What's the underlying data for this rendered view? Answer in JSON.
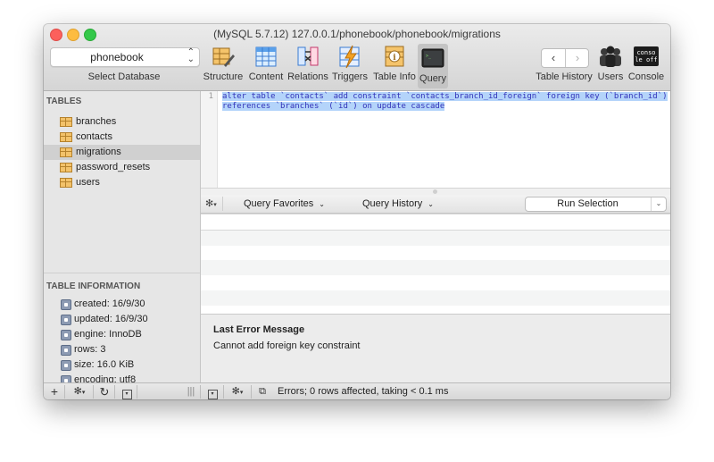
{
  "window": {
    "title": "(MySQL 5.7.12) 127.0.0.1/phonebook/phonebook/migrations"
  },
  "database": {
    "selected": "phonebook",
    "caption": "Select Database"
  },
  "toolbar": {
    "buttons": [
      {
        "label": "Structure",
        "icon": "structure-icon"
      },
      {
        "label": "Content",
        "icon": "content-icon"
      },
      {
        "label": "Relations",
        "icon": "relations-icon"
      },
      {
        "label": "Triggers",
        "icon": "triggers-icon"
      },
      {
        "label": "Table Info",
        "icon": "table-info-icon"
      },
      {
        "label": "Query",
        "icon": "query-icon",
        "active": true
      }
    ],
    "table_history": "Table History",
    "users": "Users",
    "console": "Console",
    "console_badge_top": "conso",
    "console_badge_bottom": "le off"
  },
  "sidebar": {
    "tables_heading": "TABLES",
    "tables": [
      {
        "name": "branches"
      },
      {
        "name": "contacts"
      },
      {
        "name": "migrations",
        "selected": true
      },
      {
        "name": "password_resets"
      },
      {
        "name": "users"
      }
    ],
    "info_heading": "TABLE INFORMATION",
    "info": [
      "created: 16/9/30",
      "updated: 16/9/30",
      "engine: InnoDB",
      "rows: 3",
      "size: 16.0 KiB",
      "encoding: utf8"
    ]
  },
  "editor": {
    "line_number": "1",
    "line1": "alter table `contacts` add constraint `contacts_branch_id_foreign` foreign key (`branch_id`)",
    "line2": "references `branches` (`id`) on update cascade"
  },
  "query_bar": {
    "favorites": "Query Favorites",
    "history": "Query History",
    "run": "Run Selection"
  },
  "error": {
    "title": "Last Error Message",
    "message": "Cannot add foreign key constraint"
  },
  "status": {
    "text": "Errors; 0 rows affected, taking < 0.1 ms"
  }
}
